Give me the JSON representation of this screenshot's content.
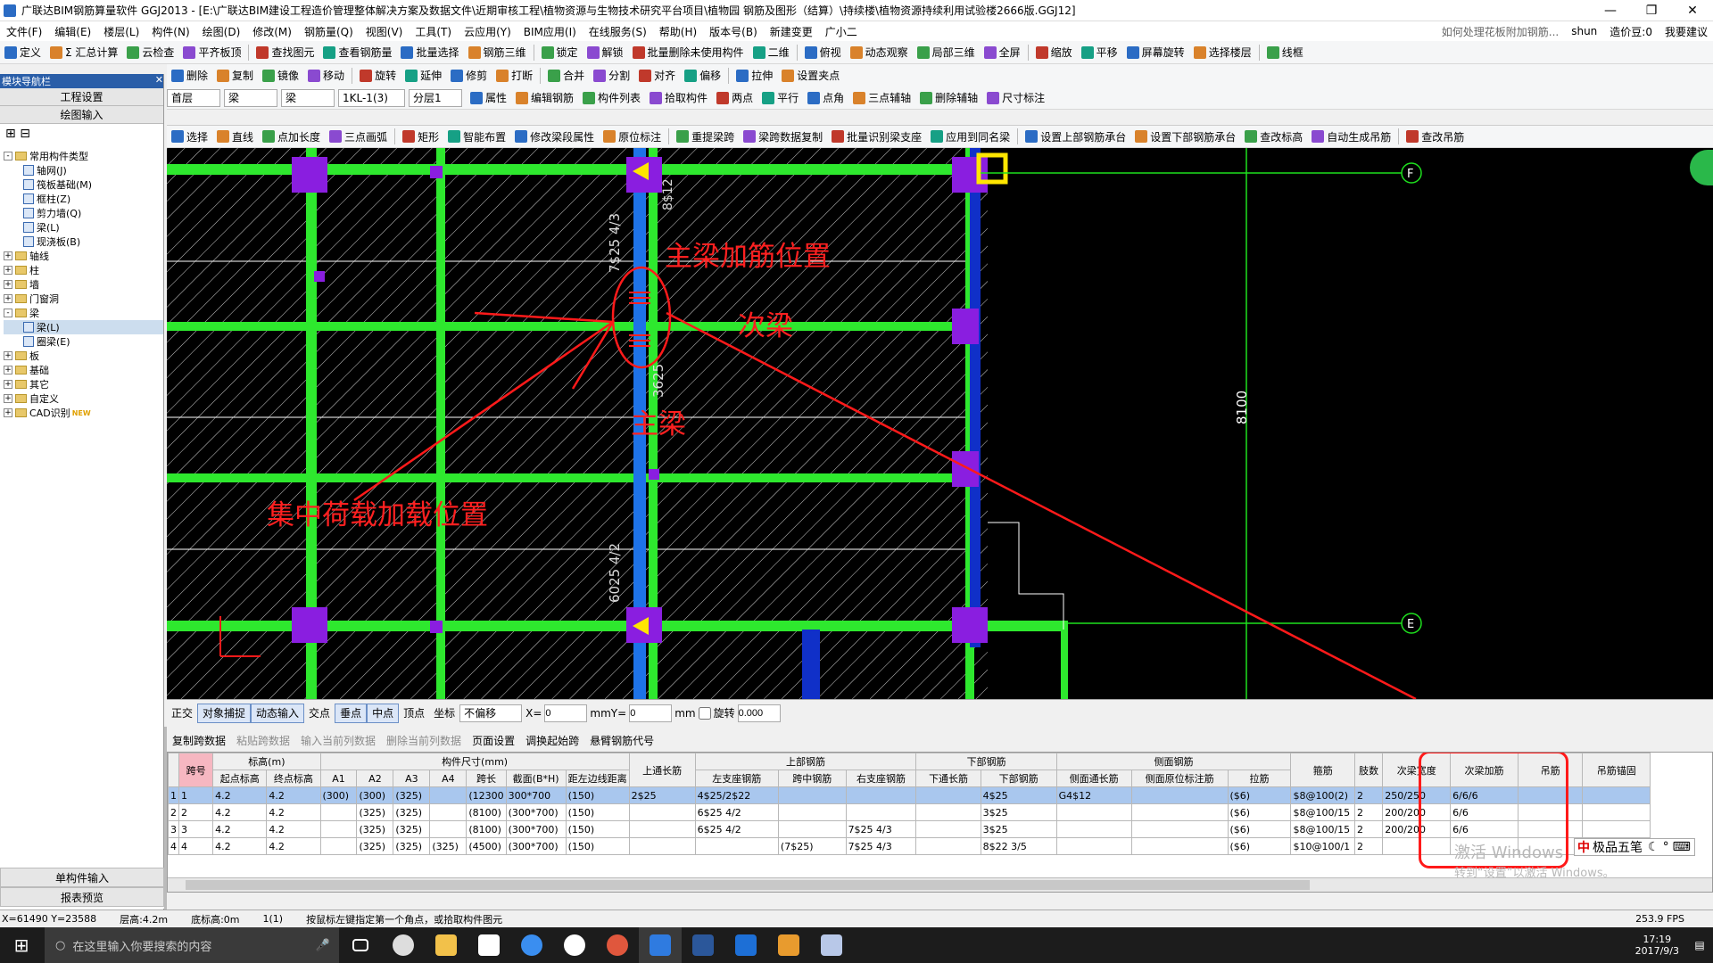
{
  "title": {
    "app_title": "广联达BIM钢筋算量软件 GGJ2013 - [E:\\广联达BIM建设工程造价管理整体解决方案及数据文件\\近期审核工程\\植物资源与生物技术研究平台项目\\植物园 钢筋及图形（结算）\\持续楼\\植物资源持续利用试验楼2666版.GGJ12]"
  },
  "menu": {
    "items": [
      "文件(F)",
      "编辑(E)",
      "楼层(L)",
      "构件(N)",
      "绘图(D)",
      "修改(M)",
      "钢筋量(Q)",
      "视图(V)",
      "工具(T)",
      "云应用(Y)",
      "BIM应用(I)",
      "在线服务(S)",
      "帮助(H)",
      "版本号(B)",
      "新建变更",
      "广小二"
    ],
    "help_question": "如何处理花板附加钢筋...",
    "user": "shun",
    "cost_beans": "造价豆:0",
    "want_suggest": "我要建议"
  },
  "toolbar1": [
    "定义",
    "Σ 汇总计算",
    "云检查",
    "平齐板顶",
    "查找图元",
    "查看钢筋量",
    "批量选择",
    "钢筋三维",
    "锁定",
    "解锁",
    "批量删除未使用构件",
    "二维",
    "俯视",
    "动态观察",
    "局部三维",
    "全屏",
    "缩放",
    "平移",
    "屏幕旋转",
    "选择楼层",
    "线框"
  ],
  "toolbar2": [
    "删除",
    "复制",
    "镜像",
    "移动",
    "旋转",
    "延伸",
    "修剪",
    "打断",
    "合并",
    "分割",
    "对齐",
    "偏移",
    "拉伸",
    "设置夹点"
  ],
  "toolbar3": {
    "floor": "首层",
    "type1": "梁",
    "type2": "梁",
    "element": "1KL-1(3)",
    "layer": "分层1",
    "actions": [
      "属性",
      "编辑钢筋",
      "构件列表",
      "拾取构件",
      "两点",
      "平行",
      "点角",
      "三点辅轴",
      "删除辅轴",
      "尺寸标注"
    ]
  },
  "toolbar4": [
    "选择",
    "直线",
    "点加长度",
    "三点画弧",
    "矩形",
    "智能布置",
    "修改梁段属性",
    "原位标注",
    "重提梁跨",
    "梁跨数据复制",
    "批量识别梁支座",
    "应用到同名梁",
    "设置上部钢筋承台",
    "设置下部钢筋承台",
    "查改标高",
    "自动生成吊筋",
    "查改吊筋"
  ],
  "panel": {
    "header": "模块导航栏",
    "section1": "工程设置",
    "section2": "绘图输入",
    "tree": [
      {
        "label": "常用构件类型",
        "level": 0,
        "type": "folder",
        "exp": "-"
      },
      {
        "label": "轴网(J)",
        "level": 1,
        "type": "item"
      },
      {
        "label": "筏板基础(M)",
        "level": 1,
        "type": "item"
      },
      {
        "label": "框柱(Z)",
        "level": 1,
        "type": "item"
      },
      {
        "label": "剪力墙(Q)",
        "level": 1,
        "type": "item"
      },
      {
        "label": "梁(L)",
        "level": 1,
        "type": "item"
      },
      {
        "label": "现浇板(B)",
        "level": 1,
        "type": "item"
      },
      {
        "label": "轴线",
        "level": 0,
        "type": "folder",
        "exp": "+"
      },
      {
        "label": "柱",
        "level": 0,
        "type": "folder",
        "exp": "+"
      },
      {
        "label": "墙",
        "level": 0,
        "type": "folder",
        "exp": "+"
      },
      {
        "label": "门窗洞",
        "level": 0,
        "type": "folder",
        "exp": "+"
      },
      {
        "label": "梁",
        "level": 0,
        "type": "folder",
        "exp": "-"
      },
      {
        "label": "梁(L)",
        "level": 1,
        "type": "item",
        "selected": true
      },
      {
        "label": "圈梁(E)",
        "level": 1,
        "type": "item"
      },
      {
        "label": "板",
        "level": 0,
        "type": "folder",
        "exp": "+"
      },
      {
        "label": "基础",
        "level": 0,
        "type": "folder",
        "exp": "+"
      },
      {
        "label": "其它",
        "level": 0,
        "type": "folder",
        "exp": "+"
      },
      {
        "label": "自定义",
        "level": 0,
        "type": "folder",
        "exp": "+"
      },
      {
        "label": "CAD识别",
        "level": 0,
        "type": "folder",
        "exp": "+",
        "badge": "NEW"
      }
    ],
    "bottom1": "单构件输入",
    "bottom2": "报表预览"
  },
  "cad": {
    "labels": {
      "main_rebar_pos": "主梁加筋位置",
      "secondary_beam": "次梁",
      "main_beam": "主梁",
      "load_pos": "集中荷载加载位置",
      "dim_top": "7$25 4/3",
      "dim_mid": "3625",
      "dim_bottom": "6025 4/2",
      "span": "8100",
      "axis_f": "F",
      "axis_e": "E",
      "top_mark": "8$12"
    }
  },
  "snap": {
    "items": [
      "正交",
      "对象捕捉",
      "动态输入",
      "交点",
      "垂点",
      "中点",
      "顶点",
      "坐标"
    ],
    "offset": "不偏移",
    "x_label": "X=",
    "x_val": "0",
    "y_label": "Y=",
    "y_val": "0",
    "unit": "mm",
    "rotate_label": "旋转",
    "rotate_val": "0.000"
  },
  "grid_toolbar": [
    "复制跨数据",
    "粘贴跨数据",
    "输入当前列数据",
    "删除当前列数据",
    "页面设置",
    "调换起始跨",
    "悬臂钢筋代号"
  ],
  "grid": {
    "groups": [
      "跨号",
      "标高(m)",
      "构件尺寸(mm)",
      "上通长筋",
      "上部钢筋",
      "下部钢筋",
      "侧面钢筋",
      "箍筋",
      "肢数",
      "次梁宽度",
      "次梁加筋",
      "吊筋",
      "吊筋锚固"
    ],
    "cols": [
      "起点标高",
      "终点标高",
      "A1",
      "A2",
      "A3",
      "A4",
      "跨长",
      "截面(B*H)",
      "距左边线距离",
      "左支座钢筋",
      "跨中钢筋",
      "右支座钢筋",
      "下通长筋",
      "下部钢筋",
      "侧面通长筋",
      "侧面原位标注筋",
      "拉筋"
    ],
    "rows": [
      [
        "1",
        "1",
        "4.2",
        "4.2",
        "(300)",
        "(300)",
        "(325)",
        "",
        "(12300",
        "300*700",
        "(150)",
        "2$25",
        "4$25/2$22",
        "",
        "",
        "",
        "4$25",
        "G4$12",
        "",
        "($6)",
        "$8@100(2)",
        "2",
        "250/250",
        "6/6/6",
        "",
        ""
      ],
      [
        "2",
        "2",
        "4.2",
        "4.2",
        "",
        "(325)",
        "(325)",
        "",
        "(8100)",
        "(300*700)",
        "(150)",
        "",
        "6$25 4/2",
        "",
        "",
        "",
        "3$25",
        "",
        "",
        "($6)",
        "$8@100/15",
        "2",
        "200/200",
        "6/6",
        "",
        ""
      ],
      [
        "3",
        "3",
        "4.2",
        "4.2",
        "",
        "(325)",
        "(325)",
        "",
        "(8100)",
        "(300*700)",
        "(150)",
        "",
        "6$25 4/2",
        "",
        "7$25 4/3",
        "",
        "3$25",
        "",
        "",
        "($6)",
        "$8@100/15",
        "2",
        "200/200",
        "6/6",
        "",
        ""
      ],
      [
        "4",
        "4",
        "4.2",
        "4.2",
        "",
        "(325)",
        "(325)",
        "(325)",
        "(4500)",
        "(300*700)",
        "(150)",
        "",
        "",
        "(7$25)",
        "7$25 4/3",
        "",
        "8$22 3/5",
        "",
        "",
        "($6)",
        "$10@100/1",
        "2",
        "",
        "",
        "",
        ""
      ]
    ]
  },
  "watermark": {
    "line1": "激活 Windows",
    "line2": "转到“设置”以激活 Windows。"
  },
  "ime": "极品五笔",
  "status": {
    "coords": "X=61490 Y=23588",
    "layer_h": "层高:4.2m",
    "base_h": "底标高:0m",
    "count": "1(1)",
    "hint": "按鼠标左键指定第一个角点，或拾取构件图元",
    "fps": "253.9 FPS"
  },
  "taskbar": {
    "search": "在这里输入你要搜索的内容",
    "time": "17:19",
    "date": "2017/9/3"
  }
}
